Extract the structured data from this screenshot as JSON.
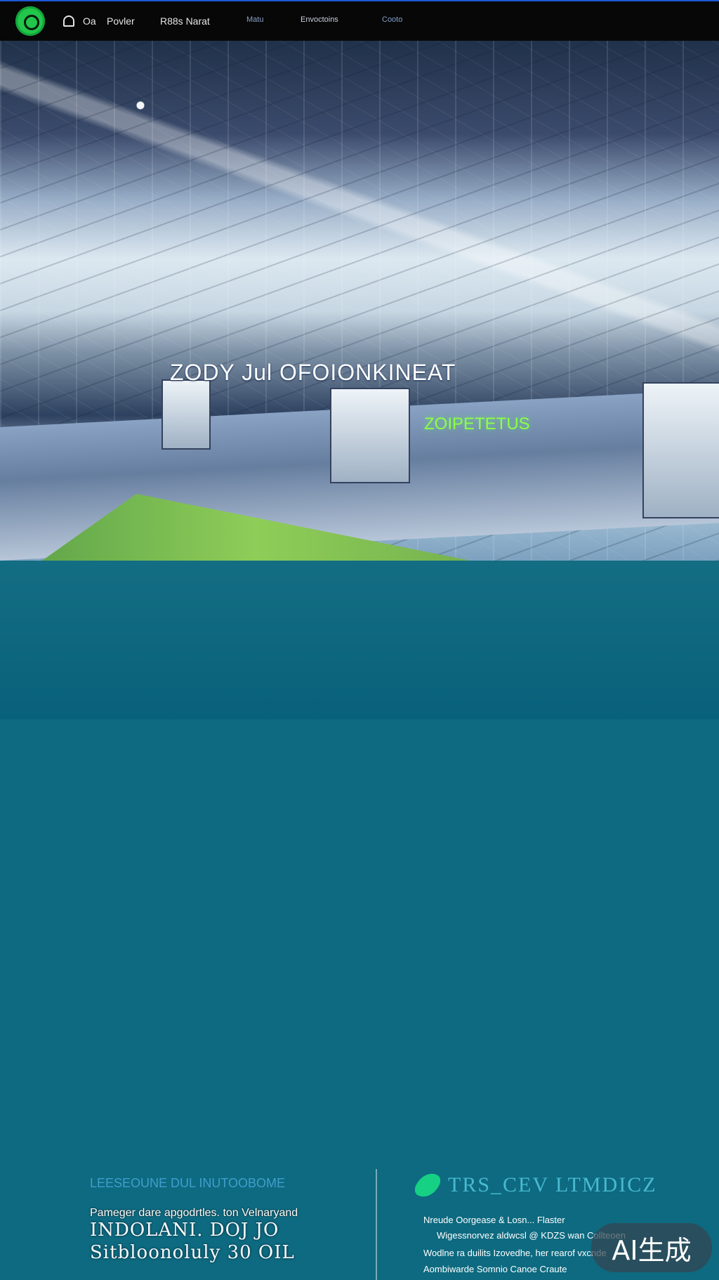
{
  "nav": {
    "items": [
      {
        "label": "Oa"
      },
      {
        "label": "Povler"
      },
      {
        "label": "R88s Narat"
      },
      {
        "label": "Matu"
      },
      {
        "label": "Envoctoins"
      },
      {
        "label": "Cooto"
      }
    ]
  },
  "hero": {
    "title": "ZODY Jul OFOIONKINEAT",
    "subtitle": "ZOIPETETUS"
  },
  "left": {
    "heading": "LEESEOUNE DUL INUTOOBOME",
    "line1": "Pameger dare apgodrtles.   ton Velnaryand",
    "big1": "INDOLANI.   DOJ   JO",
    "big2": "Sitbloonoluly   30   OIL"
  },
  "right": {
    "heading": "TRS_CEV LTMDICZ",
    "bullets": [
      "Nreude Oorgease & Losn... Flaster",
      "Wigessnorvez aldwcsl @ KDZS  wan Collteoen",
      "Wodlne ra duilits Izovedhe, her rearof vxcnde",
      "Aombiwarde Somnio Canoe Craute"
    ]
  },
  "badge": {
    "label": "AI生成"
  }
}
